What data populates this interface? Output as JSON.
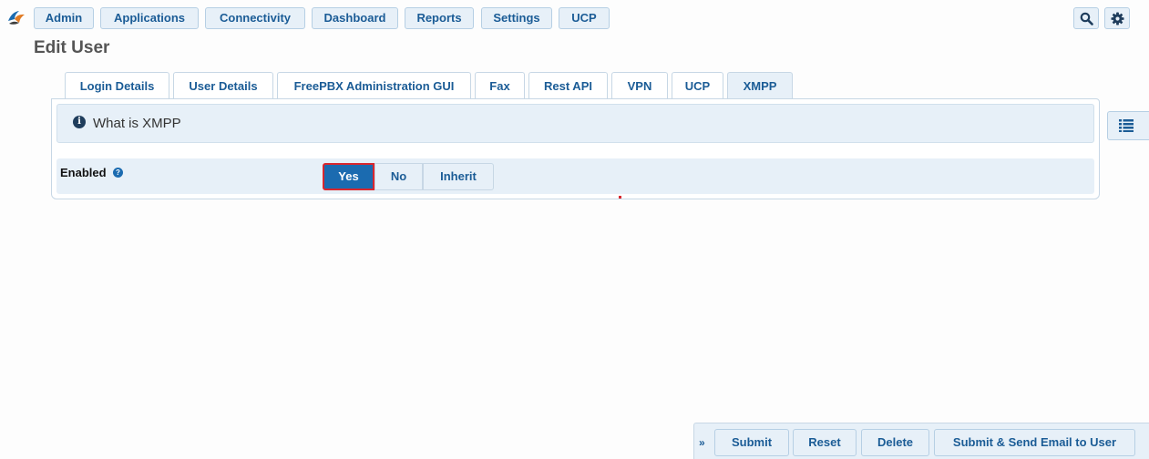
{
  "nav": {
    "items": [
      "Admin",
      "Applications",
      "Connectivity",
      "Dashboard",
      "Reports",
      "Settings",
      "UCP"
    ],
    "search_icon": "search-icon",
    "settings_icon": "gear-icon"
  },
  "page": {
    "title": "Edit User"
  },
  "tabs": [
    {
      "label": "Login Details"
    },
    {
      "label": "User Details"
    },
    {
      "label": "FreePBX Administration GUI"
    },
    {
      "label": "Fax"
    },
    {
      "label": "Rest API"
    },
    {
      "label": "VPN"
    },
    {
      "label": "UCP"
    },
    {
      "label": "XMPP",
      "active": true
    }
  ],
  "info": {
    "text": "What is XMPP",
    "icon": "info-circle-icon"
  },
  "enabled": {
    "label": "Enabled",
    "options": [
      "Yes",
      "No",
      "Inherit"
    ],
    "selected": "Yes"
  },
  "actions": {
    "collapse": "»",
    "submit": "Submit",
    "reset": "Reset",
    "delete": "Delete",
    "submit_email": "Submit & Send Email to User"
  },
  "colors": {
    "accent": "#1b6bb0",
    "highlight": "#d9272e",
    "panel_bg": "#e7f0f8",
    "link": "#1b5c96"
  }
}
